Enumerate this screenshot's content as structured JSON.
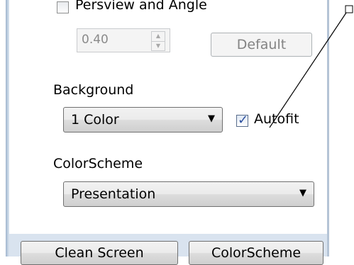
{
  "perspective": {
    "label": "Persview and Angle",
    "checked": false
  },
  "angle": {
    "value": "0.40",
    "default_label": "Default"
  },
  "background": {
    "label": "Background",
    "selected": "1 Color",
    "autofit": {
      "label": "Autofit",
      "checked": true
    }
  },
  "colorscheme": {
    "label": "ColorScheme",
    "selected": "Presentation"
  },
  "bottom_buttons": {
    "clean_screen": "Clean Screen",
    "colorscheme": "ColorScheme"
  },
  "icons": {
    "checkbox_check": "check-icon",
    "dropdown": "chevron-down-icon",
    "spin_up": "triangle-up-icon",
    "spin_down": "triangle-down-icon"
  },
  "colors": {
    "frame": "#9fb4cc",
    "check": "#2c4f9e",
    "disabled_text": "#838383"
  }
}
